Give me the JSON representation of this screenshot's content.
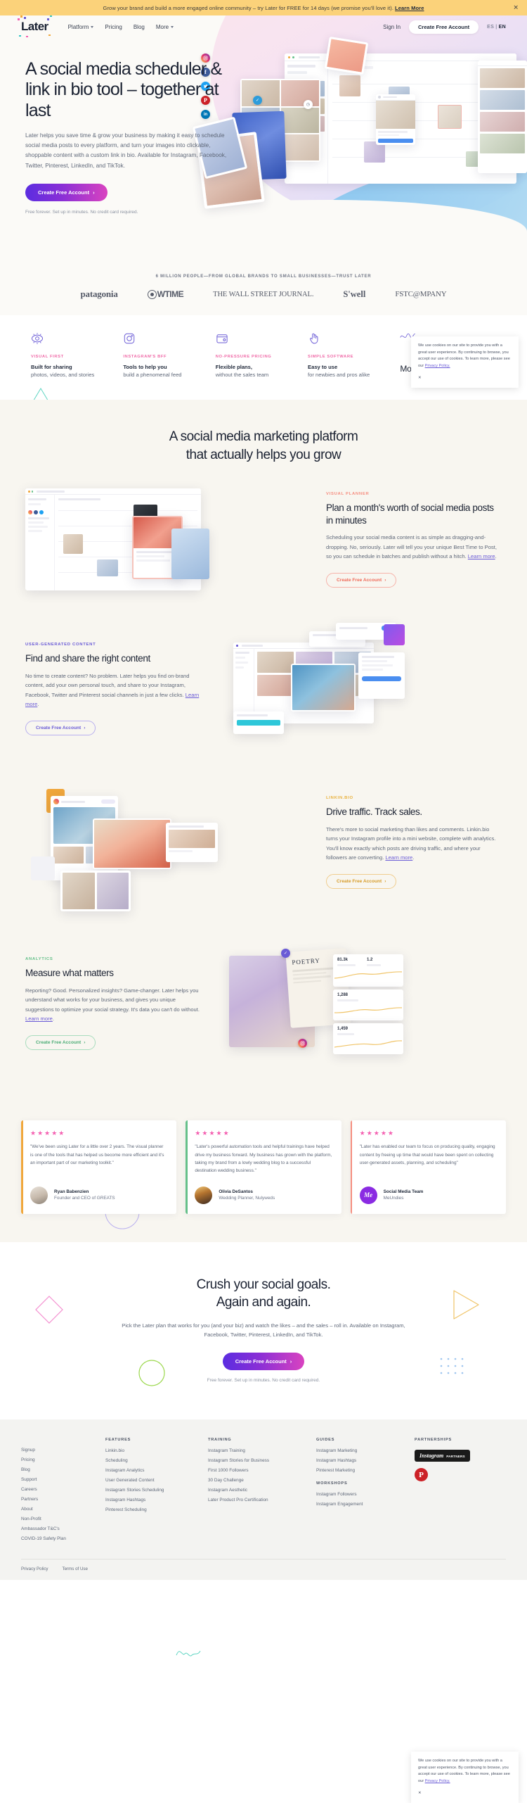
{
  "promo": {
    "text": "Grow your brand and build a more engaged online community – try Later for FREE for 14 days (we promise you'll love it).",
    "link": "Learn More",
    "close": "✕"
  },
  "nav": {
    "logo": "Later",
    "links": [
      {
        "label": "Platform",
        "caret": true
      },
      {
        "label": "Pricing",
        "caret": false
      },
      {
        "label": "Blog",
        "caret": false
      },
      {
        "label": "More",
        "caret": true
      }
    ],
    "signin": "Sign In",
    "cta": "Create Free Account",
    "lang_es": "ES",
    "lang_sep": "|",
    "lang_en": "EN"
  },
  "hero": {
    "title": "A social media scheduler & link in bio tool – together at last",
    "subtitle": "Later helps you save time & grow your business by making it easy to schedule social media posts to every platform, and turn your images into clickable, shoppable content with a custom link in bio. Available for Instagram, Facebook, Twitter, Pinterest, LinkedIn, and TikTok.",
    "cta": "Create Free Account",
    "cta_arrow": "›",
    "note": "Free forever. Set up in minutes. No credit card required."
  },
  "logostrip": {
    "label": "6 MILLION PEOPLE—FROM GLOBAL BRANDS TO SMALL BUSINESSES—TRUST LATER",
    "brands": [
      "patagonia",
      "SHOWTIME",
      "THE WALL STREET JOURNAL.",
      "S'well",
      "FSTC@MPANY"
    ]
  },
  "features": [
    {
      "icon": "eye-icon",
      "kicker": "VISUAL FIRST",
      "title": "Built for sharing",
      "desc": "photos, videos, and stories"
    },
    {
      "icon": "instagram-icon",
      "kicker": "INSTAGRAM'S BFF",
      "title": "Tools to help you",
      "desc": "build a phenomenal feed"
    },
    {
      "icon": "wallet-icon",
      "kicker": "NO-PRESSURE PRICING",
      "title": "Flexible plans,",
      "desc": "without the sales team"
    },
    {
      "icon": "hand-click-icon",
      "kicker": "SIMPLE SOFTWARE",
      "title": "Easy to use",
      "desc": "for newbies and pros alike"
    }
  ],
  "features_more": "More scheduling",
  "cookie": {
    "text_before": "We use cookies on our site to provide you with a great user experience. By continuing to browse, you accept our use of cookies. To learn more, please see our ",
    "link": "Privacy Policy.",
    "close": "✕"
  },
  "grow": {
    "title_line1": "A social media marketing platform",
    "title_line2": "that actually helps you grow"
  },
  "blocks": [
    {
      "kicker": "VISUAL PLANNER",
      "kicker_class": "k-coral",
      "title": "Plan a month's worth of social media posts in minutes",
      "body_before": "Scheduling your social media content is as simple as dragging-and-dropping. No, seriously. Later will tell you your unique Best Time to Post, so you can schedule in batches and publish without a hitch. ",
      "link": "Learn more",
      "body_after": ".",
      "cta": "Create Free Account",
      "cta_class": "o-coral"
    },
    {
      "kicker": "USER-GENERATED CONTENT",
      "kicker_class": "k-purple",
      "title": "Find and share the right content",
      "body_before": "No time to create content? No problem. Later helps you find on-brand content, add your own personal touch, and share to your Instagram, Facebook, Twitter and Pinterest social channels in just a few clicks. ",
      "link": "Learn more",
      "body_after": ".",
      "cta": "Create Free Account",
      "cta_class": "o-purple"
    },
    {
      "kicker": "LINKIN.BIO",
      "kicker_class": "k-yellow",
      "title": "Drive traffic. Track sales.",
      "body_before": "There's more to social marketing than likes and comments. Linkin.bio turns your Instagram profile into a mini website, complete with analytics. You'll know exactly which posts are driving traffic, and where your followers are converting. ",
      "link": "Learn more",
      "body_after": ".",
      "cta": "Create Free Account",
      "cta_class": "o-yellow"
    },
    {
      "kicker": "ANALYTICS",
      "kicker_class": "k-green",
      "title": "Measure what matters",
      "body_before": "Reporting? Good. Personalized insights? Game-changer. Later helps you understand what works for your business, and gives you unique suggestions to optimize your social strategy. It's data you can't do without. ",
      "link": "Learn more",
      "body_after": ".",
      "cta": "Create Free Account",
      "cta_class": "o-green"
    }
  ],
  "testimonials": [
    {
      "stars": "★★★★★",
      "quote": "\"We've been using Later for a little over 2 years. The visual planner is one of the tools that has helped us become more efficient and it's an important part of our marketing toolkit.\"",
      "name": "Ryan Babenzien",
      "role": "Founder and CEO of GREATS"
    },
    {
      "stars": "★★★★★",
      "quote": "\"Later's powerful automation tools and helpful trainings have helped drive my business forward. My business has grown with the platform, taking my brand from a lowly wedding blog to a successful destination wedding business.\"",
      "name": "Olivia DeSantos",
      "role": "Wedding Planner, Nulyweds"
    },
    {
      "stars": "★★★★★",
      "quote": "\"Later has enabled our team to focus on producing quality, engaging content by freeing up time that would have been spent on collecting user-generated assets, planning, and scheduling\"",
      "name": "Social Media Team",
      "role": "MeUndies",
      "avatar_text": "Me"
    }
  ],
  "cta": {
    "title_line1": "Crush your social goals.",
    "title_line2": "Again and again.",
    "body": "Pick the Later plan that works for you (and your biz) and watch the likes – and the sales – roll in. Available on Instagram, Facebook, Twitter, Pinterest, LinkedIn, and TikTok.",
    "button": "Create Free Account",
    "button_arrow": "›",
    "note": "Free forever. Set up in minutes. No credit card required."
  },
  "footer": {
    "col1": [
      "Signup",
      "Pricing",
      "Blog",
      "Support",
      "Careers",
      "Partners",
      "About",
      "Non-Profit",
      "Ambassador T&C's",
      "COVID-19 Safety Plan"
    ],
    "col2_head": "FEATURES",
    "col2": [
      "Linkin.bio",
      "Scheduling",
      "Instagram Analytics",
      "User Generated Content",
      "Instagram Stories Scheduling",
      "Instagram Hashtags",
      "Pinterest Scheduling"
    ],
    "col3_head": "TRAINING",
    "col3": [
      "Instagram Training",
      "Instagram Stories for Business",
      "First 1000 Followers",
      "30 Day Challenge",
      "Instagram Aesthetic",
      "Later Product Pro Certification"
    ],
    "col4_head": "GUIDES",
    "col4": [
      "Instagram Marketing",
      "Instagram Hashtags",
      "Pinterest Marketing"
    ],
    "col4b_head": "WORKSHOPS",
    "col4b": [
      "Instagram Followers",
      "Instagram Engagement"
    ],
    "col5_head": "PARTNERSHIPS",
    "partner_ig_word1": "Instagram",
    "partner_ig_word2": "PARTNERS",
    "partner_pinterest": "P",
    "bottom": [
      "Privacy Policy",
      "Terms of Use"
    ]
  }
}
